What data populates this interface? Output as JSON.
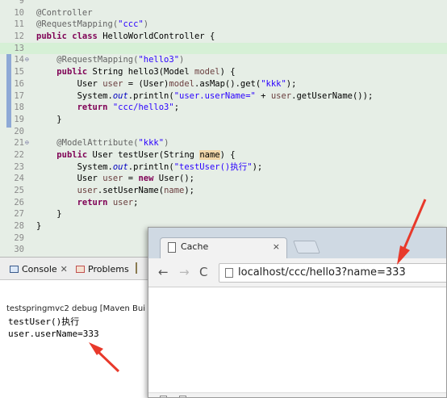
{
  "editor": {
    "lines": [
      {
        "n": "9",
        "cur": false,
        "fold": "",
        "t": []
      },
      {
        "n": "10",
        "cur": false,
        "fold": "",
        "t": [
          [
            "ann",
            "@Controller"
          ]
        ]
      },
      {
        "n": "11",
        "cur": false,
        "fold": "",
        "t": [
          [
            "ann",
            "@RequestMapping("
          ],
          [
            "str",
            "\"ccc\""
          ],
          [
            "ann",
            ")"
          ]
        ]
      },
      {
        "n": "12",
        "cur": false,
        "fold": "",
        "t": [
          [
            "kw",
            "public"
          ],
          [
            "",
            " "
          ],
          [
            "kw",
            "class"
          ],
          [
            "",
            " HelloWorldController {"
          ]
        ]
      },
      {
        "n": "13",
        "cur": true,
        "fold": "",
        "t": []
      },
      {
        "n": "14",
        "cur": false,
        "fold": "⊖",
        "t": [
          [
            "",
            "    "
          ],
          [
            "ann",
            "@RequestMapping("
          ],
          [
            "str",
            "\"hello3\""
          ],
          [
            "ann",
            ")"
          ]
        ]
      },
      {
        "n": "15",
        "cur": false,
        "fold": "",
        "t": [
          [
            "",
            "    "
          ],
          [
            "kw",
            "public"
          ],
          [
            "",
            " String hello3(Model "
          ],
          [
            "var",
            "model"
          ],
          [
            "",
            ") {"
          ]
        ]
      },
      {
        "n": "16",
        "cur": false,
        "fold": "",
        "t": [
          [
            "",
            "        User "
          ],
          [
            "var",
            "user"
          ],
          [
            "",
            " = (User)"
          ],
          [
            "var",
            "model"
          ],
          [
            "",
            ".asMap().get("
          ],
          [
            "str",
            "\"kkk\""
          ],
          [
            "",
            ");"
          ]
        ]
      },
      {
        "n": "17",
        "cur": false,
        "fold": "",
        "t": [
          [
            "",
            "        System."
          ],
          [
            "fld",
            "out"
          ],
          [
            "",
            ".println("
          ],
          [
            "str",
            "\"user.userName=\""
          ],
          [
            "",
            " + "
          ],
          [
            "var",
            "user"
          ],
          [
            "",
            ".getUserName());"
          ]
        ]
      },
      {
        "n": "18",
        "cur": false,
        "fold": "",
        "t": [
          [
            "",
            "        "
          ],
          [
            "kw",
            "return"
          ],
          [
            "",
            " "
          ],
          [
            "str",
            "\"ccc/hello3\""
          ],
          [
            "",
            ";"
          ]
        ]
      },
      {
        "n": "19",
        "cur": false,
        "fold": "",
        "t": [
          [
            "",
            "    }"
          ]
        ]
      },
      {
        "n": "20",
        "cur": false,
        "fold": "",
        "t": []
      },
      {
        "n": "21",
        "cur": false,
        "fold": "⊖",
        "t": [
          [
            "",
            "    "
          ],
          [
            "ann",
            "@ModelAttribute("
          ],
          [
            "str",
            "\"kkk\""
          ],
          [
            "ann",
            ")"
          ]
        ]
      },
      {
        "n": "22",
        "cur": false,
        "fold": "",
        "t": [
          [
            "",
            "    "
          ],
          [
            "kw",
            "public"
          ],
          [
            "",
            " User testUser(String "
          ],
          [
            "hl",
            "name"
          ],
          [
            "",
            ") {"
          ]
        ]
      },
      {
        "n": "23",
        "cur": false,
        "fold": "",
        "t": [
          [
            "",
            "        System."
          ],
          [
            "fld",
            "out"
          ],
          [
            "",
            ".println("
          ],
          [
            "str",
            "\"testUser()执行\""
          ],
          [
            "",
            ");"
          ]
        ]
      },
      {
        "n": "24",
        "cur": false,
        "fold": "",
        "t": [
          [
            "",
            "        User "
          ],
          [
            "var",
            "user"
          ],
          [
            "",
            " = "
          ],
          [
            "kw",
            "new"
          ],
          [
            "",
            " User();"
          ]
        ]
      },
      {
        "n": "25",
        "cur": false,
        "fold": "",
        "t": [
          [
            "",
            "        "
          ],
          [
            "var",
            "user"
          ],
          [
            "",
            ".setUserName("
          ],
          [
            "var",
            "name"
          ],
          [
            "",
            ");"
          ]
        ]
      },
      {
        "n": "26",
        "cur": false,
        "fold": "",
        "t": [
          [
            "",
            "        "
          ],
          [
            "kw",
            "return"
          ],
          [
            "",
            " "
          ],
          [
            "var",
            "user"
          ],
          [
            "",
            ";"
          ]
        ]
      },
      {
        "n": "27",
        "cur": false,
        "fold": "",
        "t": [
          [
            "",
            "    }"
          ]
        ]
      },
      {
        "n": "28",
        "cur": false,
        "fold": "",
        "t": [
          [
            "",
            "}"
          ]
        ]
      },
      {
        "n": "29",
        "cur": false,
        "fold": "",
        "t": []
      },
      {
        "n": "30",
        "cur": false,
        "fold": "",
        "t": []
      }
    ]
  },
  "console": {
    "tab_console": "Console",
    "tab_console_close": "✕",
    "tab_problems": "Problems",
    "status": "testspringmvc2 debug [Maven Bui",
    "output": "testUser()执行\nuser.userName=333"
  },
  "browser": {
    "tab_title": "Cache",
    "tab_close": "×",
    "back": "←",
    "forward": "→",
    "reload": "C",
    "url": "localhost/ccc/hello3?name=333"
  },
  "colors": {
    "arrow": "#e8392b",
    "editor_bg": "#e6eee6",
    "current_line": "#d6f0d6",
    "keyword": "#7f0055",
    "string": "#2a00ff"
  }
}
